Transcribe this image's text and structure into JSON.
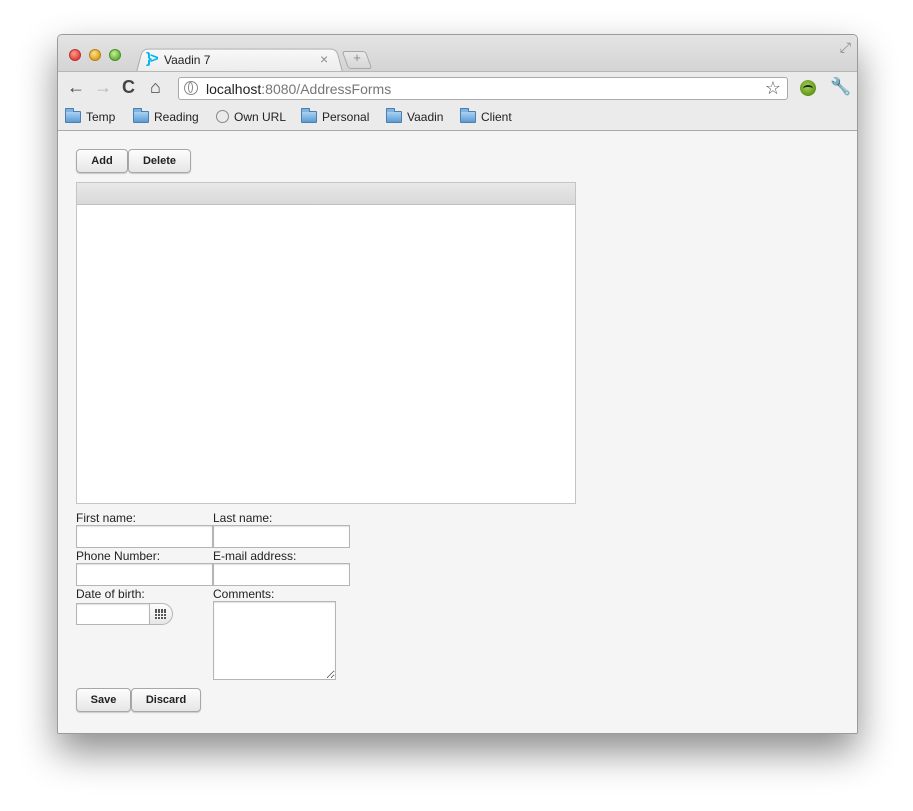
{
  "browser": {
    "tab_title": "Vaadin 7",
    "tab_icon_glyph": "}>",
    "tab_close_glyph": "×",
    "new_tab_glyph": "+",
    "url_host": "localhost",
    "url_rest": ":8080/AddressForms",
    "nav": {
      "back_glyph": "←",
      "forward_glyph": "→",
      "reload_glyph": "C",
      "home_glyph": "⌂",
      "star_glyph": "☆",
      "wrench_glyph": "🔧",
      "fullscreen_glyph": "⤢"
    },
    "bookmarks": [
      {
        "label": "Temp",
        "icon": "folder-icon"
      },
      {
        "label": "Reading",
        "icon": "folder-icon"
      },
      {
        "label": "Own URL",
        "icon": "globe-icon"
      },
      {
        "label": "Personal",
        "icon": "folder-icon"
      },
      {
        "label": "Vaadin",
        "icon": "folder-icon"
      },
      {
        "label": "Client",
        "icon": "folder-icon"
      }
    ]
  },
  "page": {
    "add_label": "Add",
    "delete_label": "Delete",
    "form": {
      "first_name_label": "First name:",
      "last_name_label": "Last name:",
      "phone_label": "Phone Number:",
      "email_label": "E-mail address:",
      "dob_label": "Date of birth:",
      "comments_label": "Comments:",
      "first_name_value": "",
      "last_name_value": "",
      "phone_value": "",
      "email_value": "",
      "dob_value": "",
      "comments_value": ""
    },
    "save_label": "Save",
    "discard_label": "Discard"
  },
  "colors": {
    "tab_icon": "#00b4f0",
    "page_background": "#f5f5f5",
    "table_header": "#dcdcdc"
  }
}
